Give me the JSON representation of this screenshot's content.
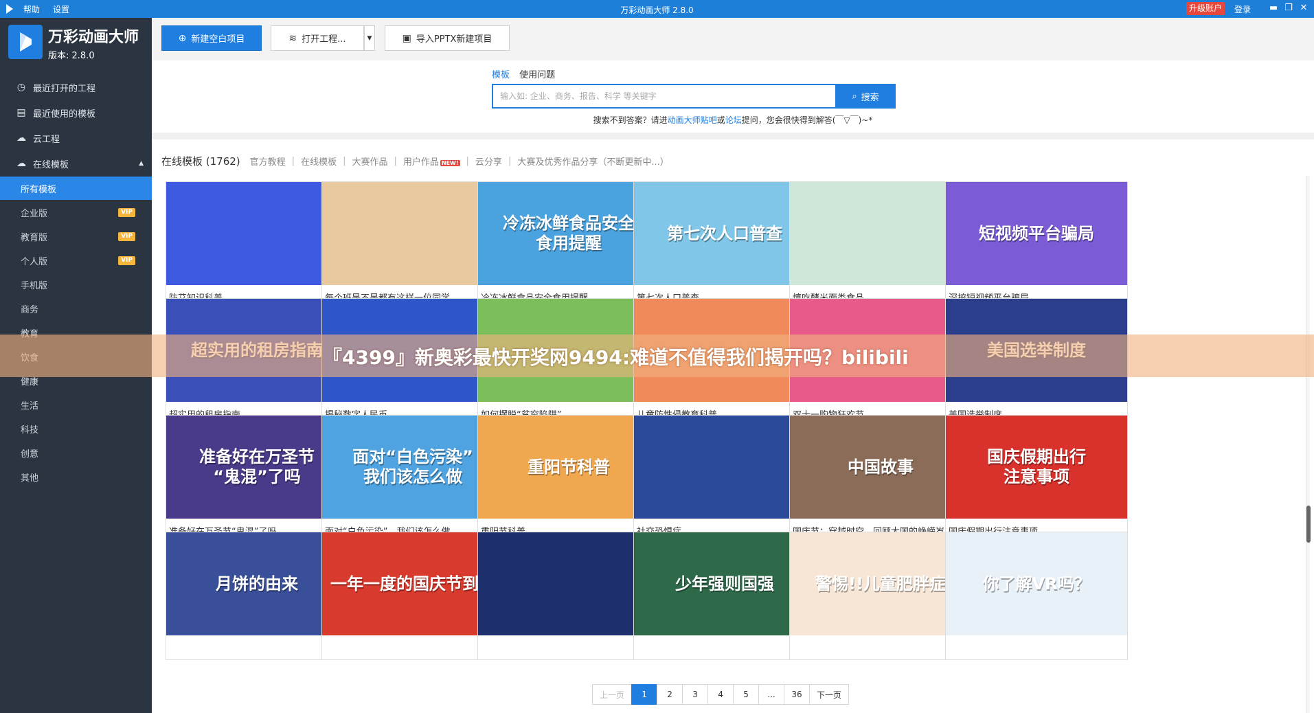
{
  "titlebar": {
    "menu_help": "帮助",
    "menu_settings": "设置",
    "title": "万彩动画大师 2.8.0",
    "upgrade": "升级账户",
    "login": "登录"
  },
  "sidebar": {
    "logo_title": "万彩动画大师",
    "version": "版本: 2.8.0",
    "items": [
      {
        "label": "最近打开的工程",
        "icon": "clock-icon"
      },
      {
        "label": "最近使用的模板",
        "icon": "template-icon"
      },
      {
        "label": "云工程",
        "icon": "cloud-icon"
      },
      {
        "label": "在线模板",
        "icon": "cloud-icon"
      }
    ],
    "subitems": [
      {
        "label": "所有模板"
      },
      {
        "label": "企业版",
        "badge": "VIP"
      },
      {
        "label": "教育版",
        "badge": "VIP"
      },
      {
        "label": "个人版",
        "badge": "VIP"
      },
      {
        "label": "手机版"
      },
      {
        "label": "商务"
      },
      {
        "label": "教育"
      },
      {
        "label": "饮食"
      },
      {
        "label": "健康"
      },
      {
        "label": "生活"
      },
      {
        "label": "科技"
      },
      {
        "label": "创意"
      },
      {
        "label": "其他"
      }
    ]
  },
  "toolbar": {
    "new_project": "新建空白项目",
    "open_project": "打开工程...",
    "import_pptx": "导入PPTX新建项目"
  },
  "search": {
    "tab_template": "模板",
    "tab_question": "使用问题",
    "placeholder": "输入如: 企业、商务、报告、科学 等关键字",
    "button": "搜索",
    "hint_prefix": "搜索不到答案？请进",
    "hint_link1": "动画大师贴吧",
    "hint_or": "或",
    "hint_link2": "论坛",
    "hint_suffix": "提问，您会很快得到解答(￣▽￣)~*"
  },
  "categories": {
    "head": "在线模板 (1762)",
    "items": [
      "官方教程",
      "在线模板",
      "大赛作品",
      "用户作品",
      "云分享",
      "大赛及优秀作品分享（不断更新中...）"
    ],
    "new_badge": "NEW!"
  },
  "templates": [
    {
      "label": "防艾知识科普",
      "thumb_text": "",
      "bg": "#3d5ae0"
    },
    {
      "label": "每个班是不是都有这样一位同学",
      "thumb_text": "",
      "bg": "#e9c9a0"
    },
    {
      "label": "冷冻冰鲜食品安全食用提醒",
      "thumb_text": "冷冻冰鲜食品安全\n食用提醒",
      "bg": "#4aa3df"
    },
    {
      "label": "第七次人口普查",
      "thumb_text": "第七次人口普查",
      "bg": "#7fc6e8"
    },
    {
      "label": "慎吃酵米面类食品",
      "thumb_text": "",
      "bg": "#cfe7d8"
    },
    {
      "label": "深挖短视频平台骗局",
      "thumb_text": "短视频平台骗局",
      "bg": "#7b5cd6"
    },
    {
      "label": "超实用的租房指南",
      "thumb_text": "超实用的租房指南",
      "bg": "#3b4fb8"
    },
    {
      "label": "揭秘数字人民币",
      "thumb_text": "",
      "bg": "#2f56c9"
    },
    {
      "label": "如何摆脱“贫穷陷阱”",
      "thumb_text": "",
      "bg": "#7cbf5a"
    },
    {
      "label": "儿童防性侵教育科普",
      "thumb_text": "",
      "bg": "#f08a5a"
    },
    {
      "label": "双十一购物狂欢节",
      "thumb_text": "",
      "bg": "#e85a8a"
    },
    {
      "label": "美国选举制度",
      "thumb_text": "美国选举制度",
      "bg": "#2a3e8c"
    },
    {
      "label": "准备好在万圣节“鬼混”了吗",
      "thumb_text": "准备好在万圣节\n“鬼混”了吗",
      "bg": "#4b3a8a"
    },
    {
      "label": "面对“白色污染”，我们该怎么做",
      "thumb_text": "面对“白色污染”\n我们该怎么做",
      "bg": "#4fa3e0"
    },
    {
      "label": "重阳节科普",
      "thumb_text": "重阳节科普",
      "bg": "#f0a850"
    },
    {
      "label": "社交恐惧症",
      "thumb_text": "",
      "bg": "#2b4a9a"
    },
    {
      "label": "国庆节：穿越时空，回顾大国的峥嵘岁...",
      "thumb_text": "中国故事",
      "bg": "#8a6c58"
    },
    {
      "label": "国庆假期出行注意事项",
      "thumb_text": "国庆假期出行\n注意事项",
      "bg": "#d9312c"
    },
    {
      "label": "",
      "thumb_text": "月饼的由来",
      "bg": "#3a4f9a"
    },
    {
      "label": "",
      "thumb_text": "一年一度的国庆节到啦",
      "bg": "#d93a2e"
    },
    {
      "label": "",
      "thumb_text": "",
      "bg": "#1e2f6e"
    },
    {
      "label": "",
      "thumb_text": "少年强则国强",
      "bg": "#2e6a4a"
    },
    {
      "label": "",
      "thumb_text": "警惕!!儿童肥胖症",
      "bg": "#f7e6d5"
    },
    {
      "label": "",
      "thumb_text": "你了解VR吗？",
      "bg": "#e8f0f8"
    }
  ],
  "pagination": [
    "上一页",
    "1",
    "2",
    "3",
    "4",
    "5",
    "...",
    "36",
    "下一页"
  ],
  "overlay": {
    "text": "『4399』新奥彩最快开奖网9494:难道不值得我们揭开吗？bilibili"
  }
}
